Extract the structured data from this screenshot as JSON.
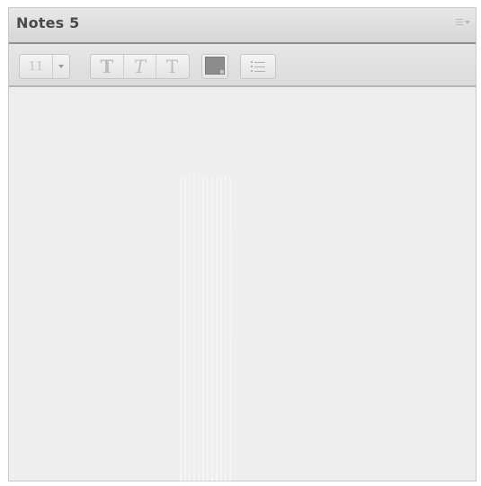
{
  "window": {
    "title": "Notes 5"
  },
  "toolbar": {
    "font_size_value": "11",
    "bold_label": "T",
    "italic_label": "T",
    "plain_label": "T",
    "text_color": "#8c8c8c"
  },
  "icons": {
    "menu": "panel-menu-icon",
    "dropdown": "chevron-down-icon",
    "bold": "bold-icon",
    "italic": "italic-icon",
    "plain": "plain-text-icon",
    "color": "color-swatch-icon",
    "list": "bullet-list-icon"
  },
  "content": {
    "text": ""
  }
}
